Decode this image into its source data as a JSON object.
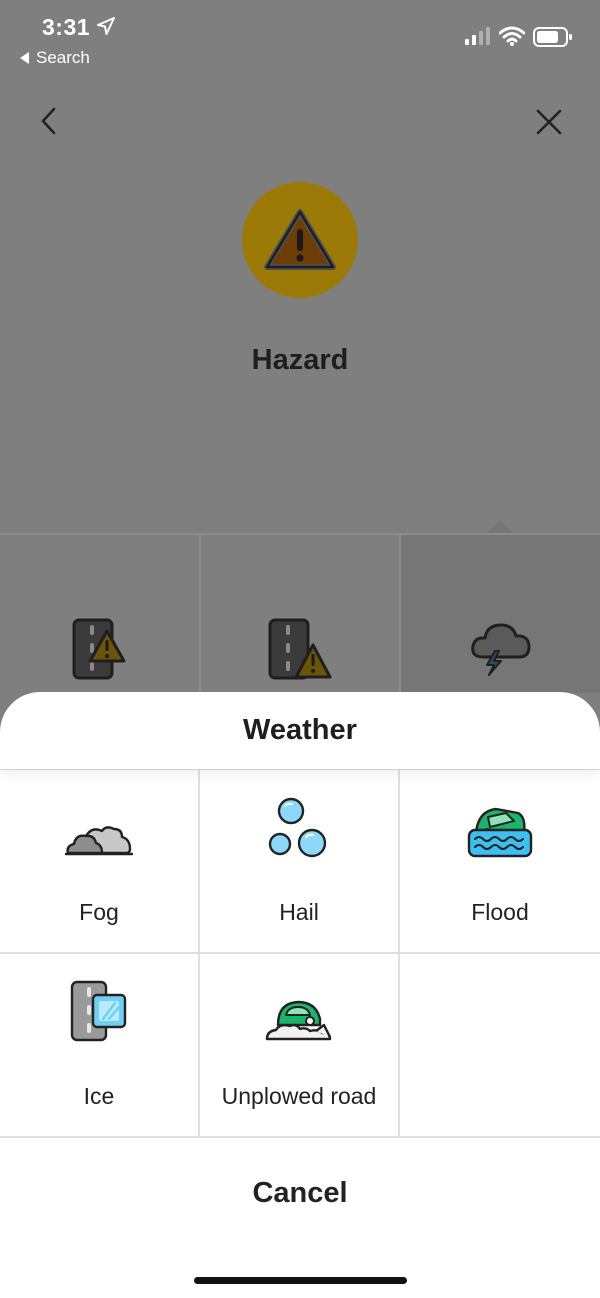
{
  "status_bar": {
    "time": "3:31",
    "back_app_label": "Search"
  },
  "hazard": {
    "title": "Hazard",
    "accent_color": "#9c7a08",
    "icon": "warning-triangle-icon"
  },
  "background_categories": [
    {
      "icon": "road-hazard-icon"
    },
    {
      "icon": "shoulder-hazard-icon"
    },
    {
      "icon": "weather-storm-icon"
    }
  ],
  "sheet": {
    "title": "Weather",
    "options": [
      {
        "label": "Fog",
        "icon": "fog-icon"
      },
      {
        "label": "Hail",
        "icon": "hail-icon"
      },
      {
        "label": "Flood",
        "icon": "flood-icon"
      },
      {
        "label": "Ice",
        "icon": "ice-icon"
      },
      {
        "label": "Unplowed road",
        "icon": "unplowed-road-icon"
      }
    ],
    "cancel_label": "Cancel"
  }
}
